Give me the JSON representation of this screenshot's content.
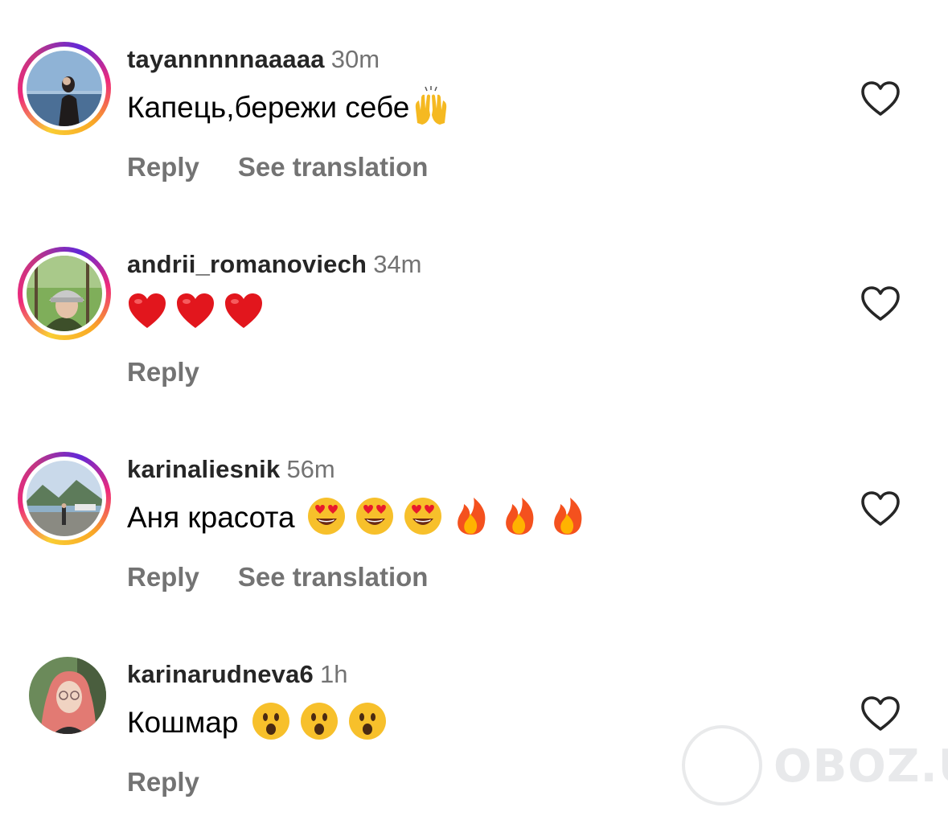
{
  "comments": [
    {
      "username": "tayannnnnaaaaa",
      "time": "30m",
      "text": "Капець,бережи себе",
      "emoji": [
        "raising-hands"
      ],
      "reply_label": "Reply",
      "translate_label": "See translation",
      "has_story_ring": true
    },
    {
      "username": "andrii_romanoviech",
      "time": "34m",
      "text": "",
      "emoji": [
        "red-heart",
        "red-heart",
        "red-heart"
      ],
      "reply_label": "Reply",
      "has_story_ring": true
    },
    {
      "username": "karinaliesnik",
      "time": "56m",
      "text": "Аня красота",
      "emoji": [
        "heart-eyes",
        "heart-eyes",
        "heart-eyes",
        "fire",
        "fire",
        "fire"
      ],
      "reply_label": "Reply",
      "translate_label": "See translation",
      "has_story_ring": true
    },
    {
      "username": "karinarudneva6",
      "time": "1h",
      "text": "Кошмар",
      "emoji": [
        "astonished",
        "astonished",
        "astonished"
      ],
      "reply_label": "Reply",
      "has_story_ring": false
    }
  ],
  "like_icon": "heart-outline-icon",
  "watermark": {
    "text": "OBOZ.UA"
  },
  "colors": {
    "username": "#262626",
    "secondary": "#737373",
    "ring_start": "#f9ce34",
    "ring_mid": "#ee2a7b",
    "ring_end": "#6228d7"
  }
}
